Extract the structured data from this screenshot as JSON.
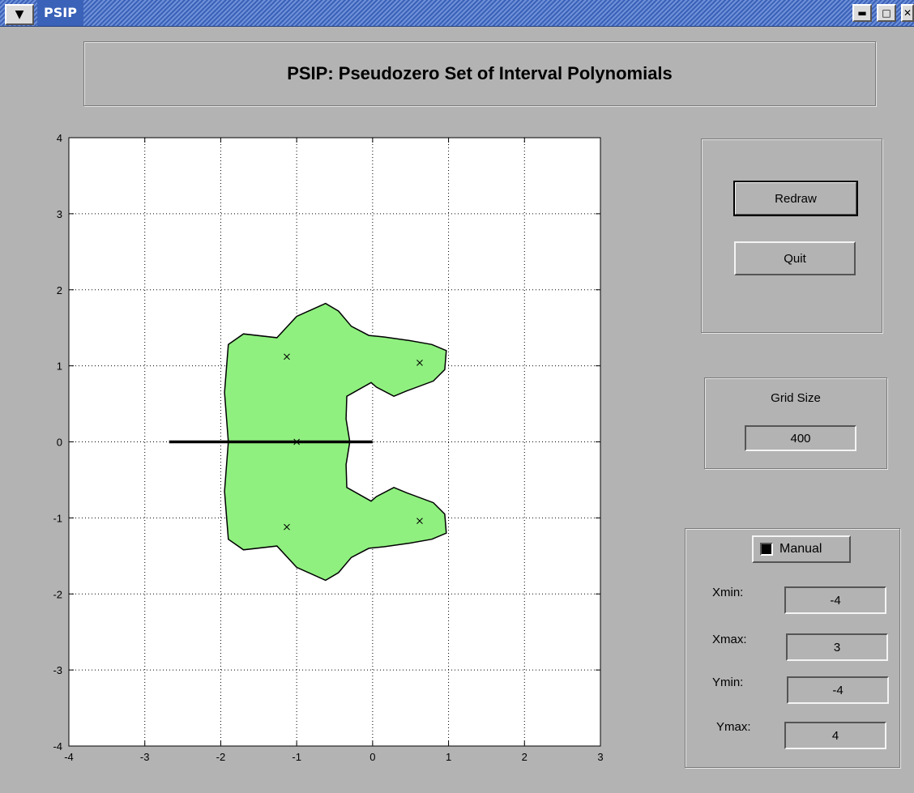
{
  "window": {
    "title": "PSIP"
  },
  "header": {
    "title": "PSIP: Pseudozero Set of Interval Polynomials"
  },
  "buttons": {
    "redraw": "Redraw",
    "quit": "Quit"
  },
  "grid": {
    "label": "Grid Size",
    "value": "400"
  },
  "limits": {
    "manual_label": "Manual",
    "manual_checked": true,
    "xmin_label": "Xmin:",
    "xmin": "-4",
    "xmax_label": "Xmax:",
    "xmax": "3",
    "ymin_label": "Ymin:",
    "ymin": "-4",
    "ymax_label": "Ymax:",
    "ymax": "4"
  },
  "colors": {
    "region_fill": "#8ff07f",
    "background": "#b3b3b3",
    "titlebar": "#3a62b8"
  },
  "chart_data": {
    "type": "scatter",
    "title": "",
    "xlabel": "",
    "ylabel": "",
    "xlim": [
      -4,
      3
    ],
    "ylim": [
      -4,
      4
    ],
    "grid": true,
    "xticks": [
      -4,
      -3,
      -2,
      -1,
      0,
      1,
      2,
      3
    ],
    "yticks": [
      -4,
      -3,
      -2,
      -1,
      0,
      1,
      2,
      3,
      4
    ],
    "zeros": [
      {
        "x": -1.13,
        "y": 1.12
      },
      {
        "x": 0.62,
        "y": 1.04
      },
      {
        "x": -1.0,
        "y": 0.0
      },
      {
        "x": -1.13,
        "y": -1.12
      },
      {
        "x": 0.62,
        "y": -1.04
      }
    ],
    "real_segment": {
      "x": [
        -2.68,
        0.0
      ],
      "y": 0
    },
    "pseudozero_region": [
      [
        -1.26,
        1.37
      ],
      [
        -1.0,
        1.65
      ],
      [
        -0.62,
        1.82
      ],
      [
        -0.45,
        1.72
      ],
      [
        -0.28,
        1.52
      ],
      [
        -0.05,
        1.4
      ],
      [
        0.15,
        1.38
      ],
      [
        0.5,
        1.33
      ],
      [
        0.78,
        1.28
      ],
      [
        0.97,
        1.2
      ],
      [
        0.95,
        0.95
      ],
      [
        0.8,
        0.8
      ],
      [
        0.45,
        0.67
      ],
      [
        0.28,
        0.6
      ],
      [
        0.05,
        0.72
      ],
      [
        -0.02,
        0.78
      ],
      [
        -0.34,
        0.6
      ],
      [
        -0.35,
        0.3
      ],
      [
        -0.3,
        0.0
      ],
      [
        -0.35,
        -0.3
      ],
      [
        -0.34,
        -0.6
      ],
      [
        -0.02,
        -0.78
      ],
      [
        0.05,
        -0.72
      ],
      [
        0.28,
        -0.6
      ],
      [
        0.45,
        -0.67
      ],
      [
        0.8,
        -0.8
      ],
      [
        0.95,
        -0.95
      ],
      [
        0.97,
        -1.2
      ],
      [
        0.78,
        -1.28
      ],
      [
        0.5,
        -1.33
      ],
      [
        0.15,
        -1.38
      ],
      [
        -0.05,
        -1.4
      ],
      [
        -0.28,
        -1.52
      ],
      [
        -0.45,
        -1.72
      ],
      [
        -0.62,
        -1.82
      ],
      [
        -1.0,
        -1.65
      ],
      [
        -1.26,
        -1.37
      ],
      [
        -1.7,
        -1.42
      ],
      [
        -1.9,
        -1.28
      ],
      [
        -1.95,
        -0.65
      ],
      [
        -1.9,
        0.0
      ],
      [
        -1.95,
        0.65
      ],
      [
        -1.9,
        1.28
      ],
      [
        -1.7,
        1.42
      ]
    ]
  }
}
